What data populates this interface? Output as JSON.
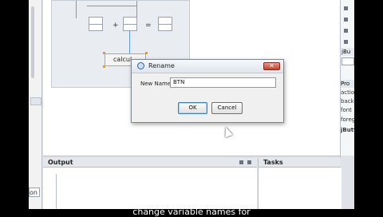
{
  "form": {
    "operator_plus": "+",
    "operator_equals": "=",
    "calc_button_label": "calcul"
  },
  "palette": {
    "button_item": "jBu"
  },
  "properties": {
    "header": "Pro",
    "rows": [
      "action",
      "back",
      "font",
      "foreg",
      "jButt"
    ]
  },
  "output": {
    "title": "Output"
  },
  "tasks": {
    "title": "Tasks"
  },
  "left_tag": "on",
  "dialog": {
    "title": "Rename",
    "label": "New Name:",
    "value": "BTN",
    "ok": "OK",
    "cancel": "Cancel"
  },
  "caption": "change variable names for"
}
